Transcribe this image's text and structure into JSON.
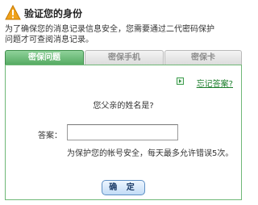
{
  "header": {
    "icon": "warning-icon",
    "title": "验证您的身份",
    "notice_line1": "为了确保您的消息记录信息安全，您需要通过二代密码保护",
    "notice_line2": "问题才可查阅消息记录。"
  },
  "tabs": [
    {
      "label": "密保问题",
      "active": true
    },
    {
      "label": "密保手机",
      "active": false
    },
    {
      "label": "密保卡",
      "active": false
    }
  ],
  "panel": {
    "forgot_link": "忘记答案?",
    "question": "您父亲的姓名是?",
    "answer_label": "答案：",
    "answer_value": "",
    "hint": "为保护您的帐号安全，每天最多允许错误5次。",
    "ok_label": "确 定"
  },
  "colors": {
    "tab_active": "#4fa65c",
    "panel_border": "#6fb877",
    "link": "#1a7d2a",
    "warning_icon": "#f0a21a"
  }
}
